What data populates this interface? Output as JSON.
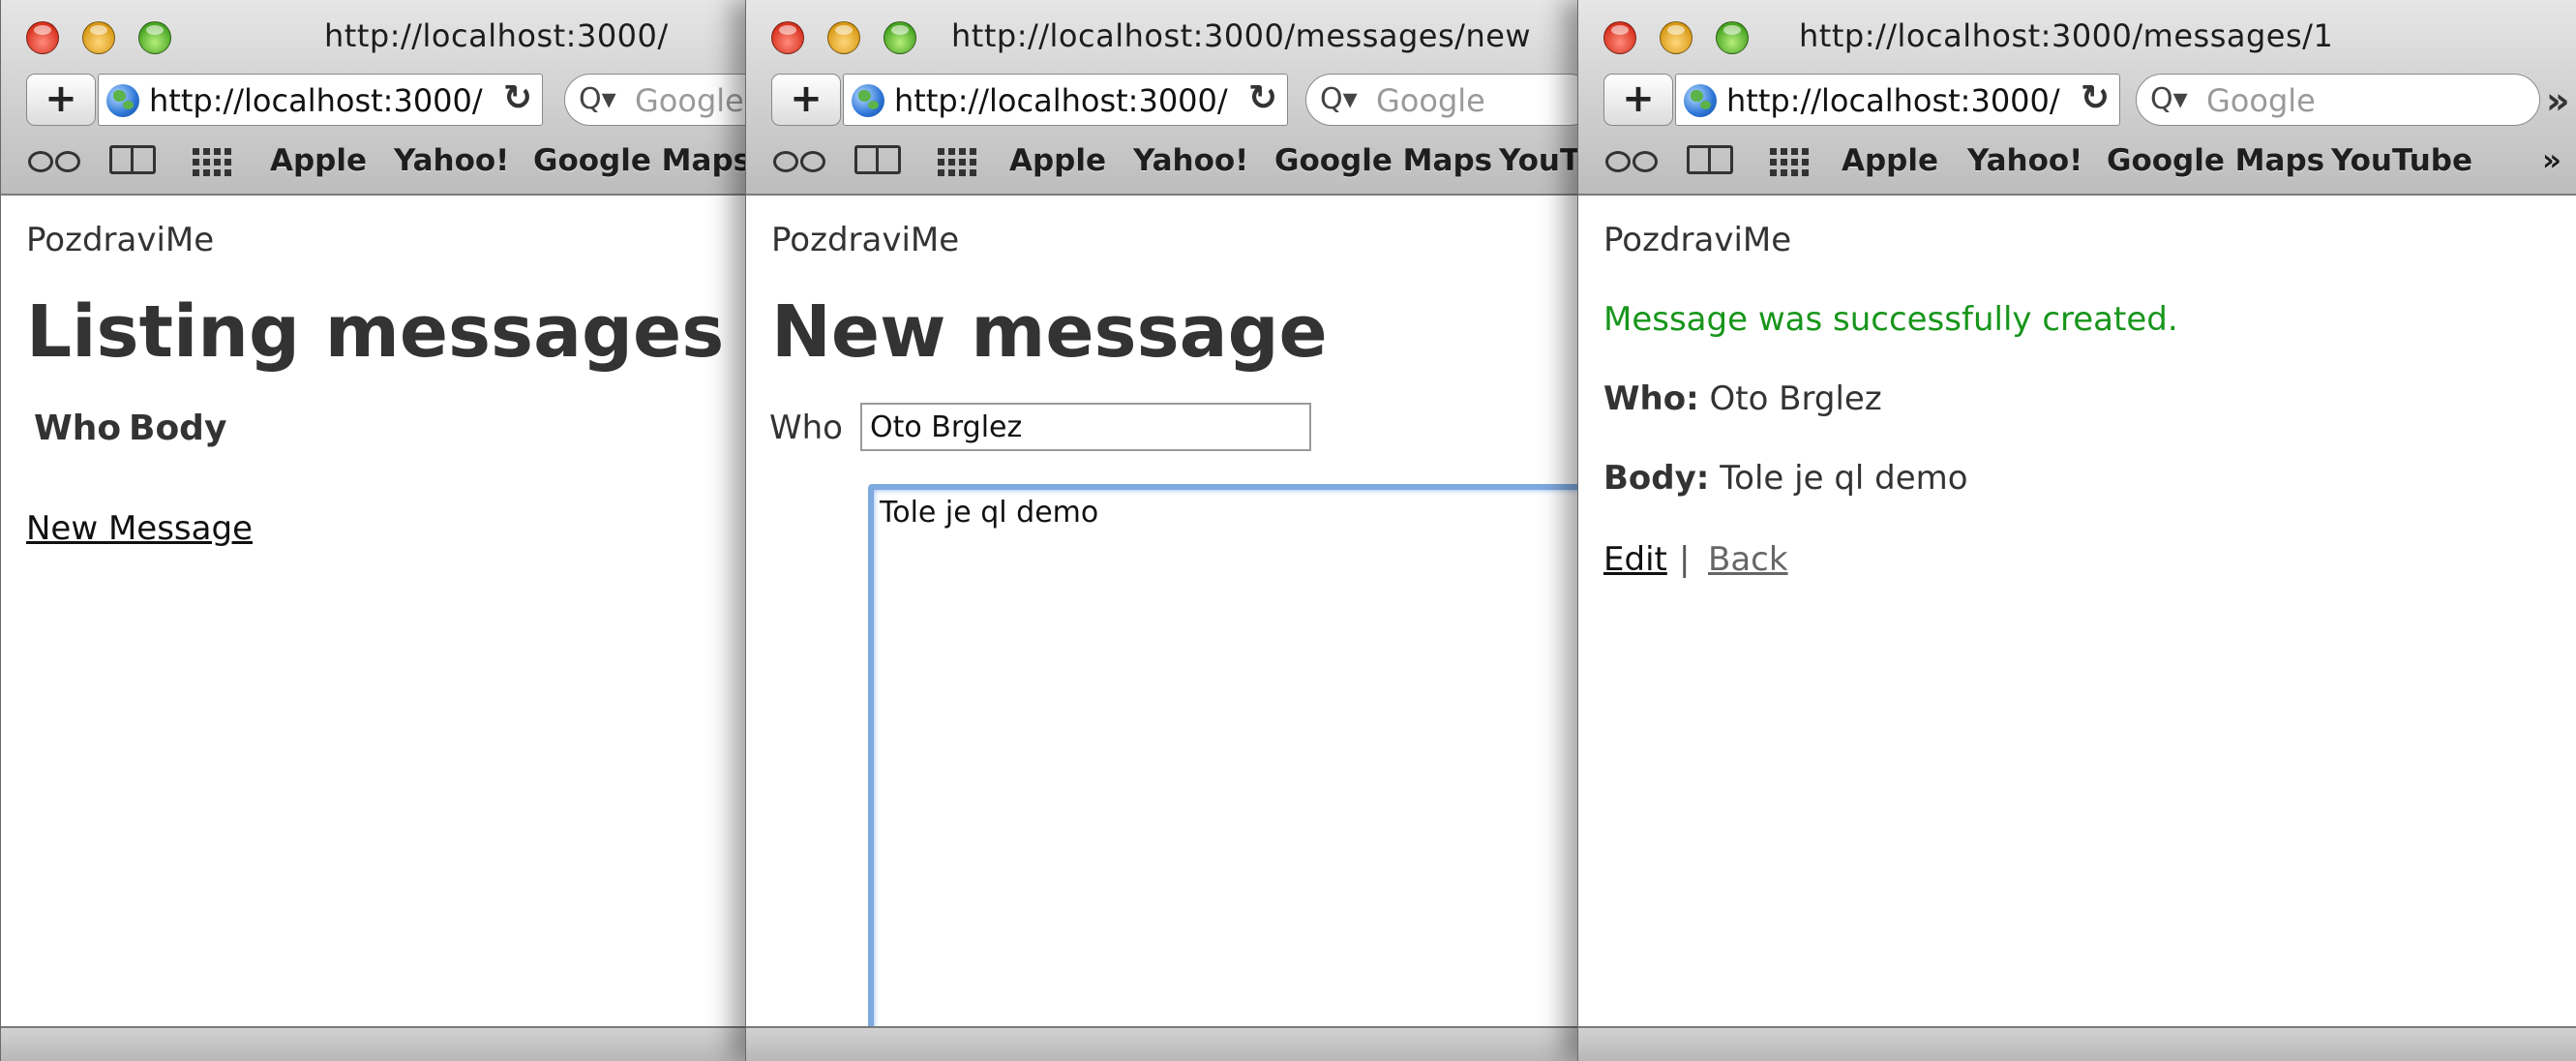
{
  "windows": [
    {
      "title": "http://localhost:3000/",
      "url": "http://localhost:3000/",
      "search_placeholder": "Google",
      "bookmarks": [
        "Apple",
        "Yahoo!",
        "Google Maps"
      ],
      "site_name": "PozdraviMe",
      "heading": "Listing messages",
      "table_headers": [
        "Who",
        "Body"
      ],
      "new_link": "New Message"
    },
    {
      "title": "http://localhost:3000/messages/new",
      "url": "http://localhost:3000/",
      "search_placeholder": "Google",
      "bookmarks": [
        "Apple",
        "Yahoo!",
        "Google Maps",
        "YouT"
      ],
      "site_name": "PozdraviMe",
      "heading": "New message",
      "who_label": "Who",
      "who_value": "Oto Brglez",
      "body_value": "Tole je ql demo"
    },
    {
      "title": "http://localhost:3000/messages/1",
      "url": "http://localhost:3000/",
      "search_placeholder": "Google",
      "bookmarks": [
        "Apple",
        "Yahoo!",
        "Google Maps",
        "YouTube"
      ],
      "more": "»",
      "site_name": "PozdraviMe",
      "flash": "Message was successfully created.",
      "who_label": "Who:",
      "who_value": "Oto Brglez",
      "body_label": "Body:",
      "body_value": "Tole je ql demo",
      "edit_link": "Edit",
      "separator": "|",
      "back_link": "Back"
    }
  ],
  "icons": {
    "add": "+",
    "reload": "↻",
    "search": "Q▾"
  },
  "colors": {
    "flash_green": "#17951b",
    "focus_blue": "#7ea9df"
  }
}
